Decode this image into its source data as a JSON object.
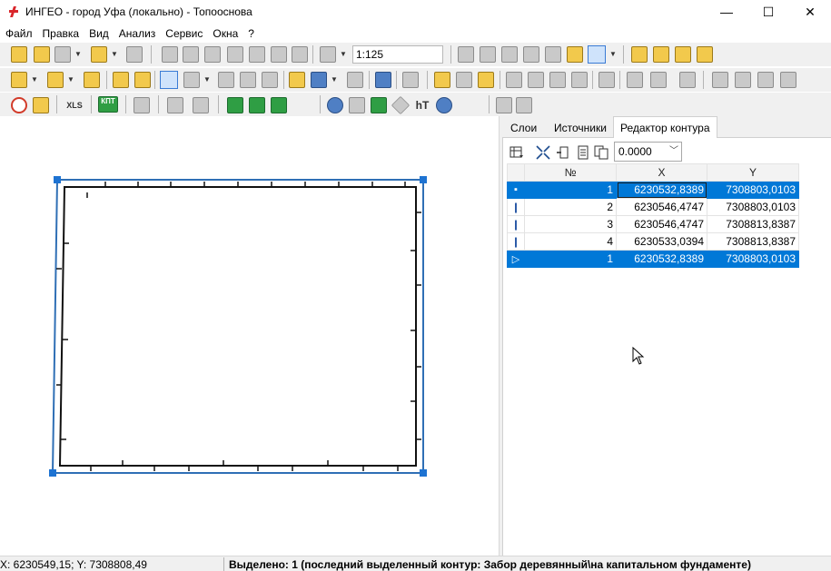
{
  "window": {
    "title": "ИНГЕО - город Уфа (локально) - Топооснова",
    "minimize": "—",
    "maximize": "☐",
    "close": "✕"
  },
  "menu": [
    "Файл",
    "Правка",
    "Вид",
    "Анализ",
    "Сервис",
    "Окна",
    "?"
  ],
  "toolbar": {
    "scale": "1:125",
    "xls_label": "XLS",
    "kpt_label": "КПТ",
    "ht_label": "hT"
  },
  "panel": {
    "tabs": [
      "Слои",
      "Источники",
      "Редактор контура"
    ],
    "active_tab": 2,
    "tolerance": "0.0000"
  },
  "grid": {
    "headers": [
      "№",
      "X",
      "Y"
    ],
    "rows": [
      {
        "marker": "▪",
        "n": "1",
        "x": "6230532,8389",
        "y": "7308803,0103",
        "selected": true
      },
      {
        "marker": "❙",
        "n": "2",
        "x": "6230546,4747",
        "y": "7308803,0103",
        "selected": false
      },
      {
        "marker": "❙",
        "n": "3",
        "x": "6230546,4747",
        "y": "7308813,8387",
        "selected": false
      },
      {
        "marker": "❙",
        "n": "4",
        "x": "6230533,0394",
        "y": "7308813,8387",
        "selected": false
      },
      {
        "marker": "▷",
        "n": "1",
        "x": "6230532,8389",
        "y": "7308803,0103",
        "selected": true
      }
    ]
  },
  "status": {
    "coords": "X: 6230549,15; Y: 7308808,49",
    "selection": "Выделено: 1 (последний выделенный контур: Забор деревянный\\на капитальном фундаменте)"
  },
  "colors": {
    "selection": "#0078d7",
    "contour_selected": "#2f6fb5",
    "contour_inner": "#000000",
    "handle": "#1e73d2"
  }
}
